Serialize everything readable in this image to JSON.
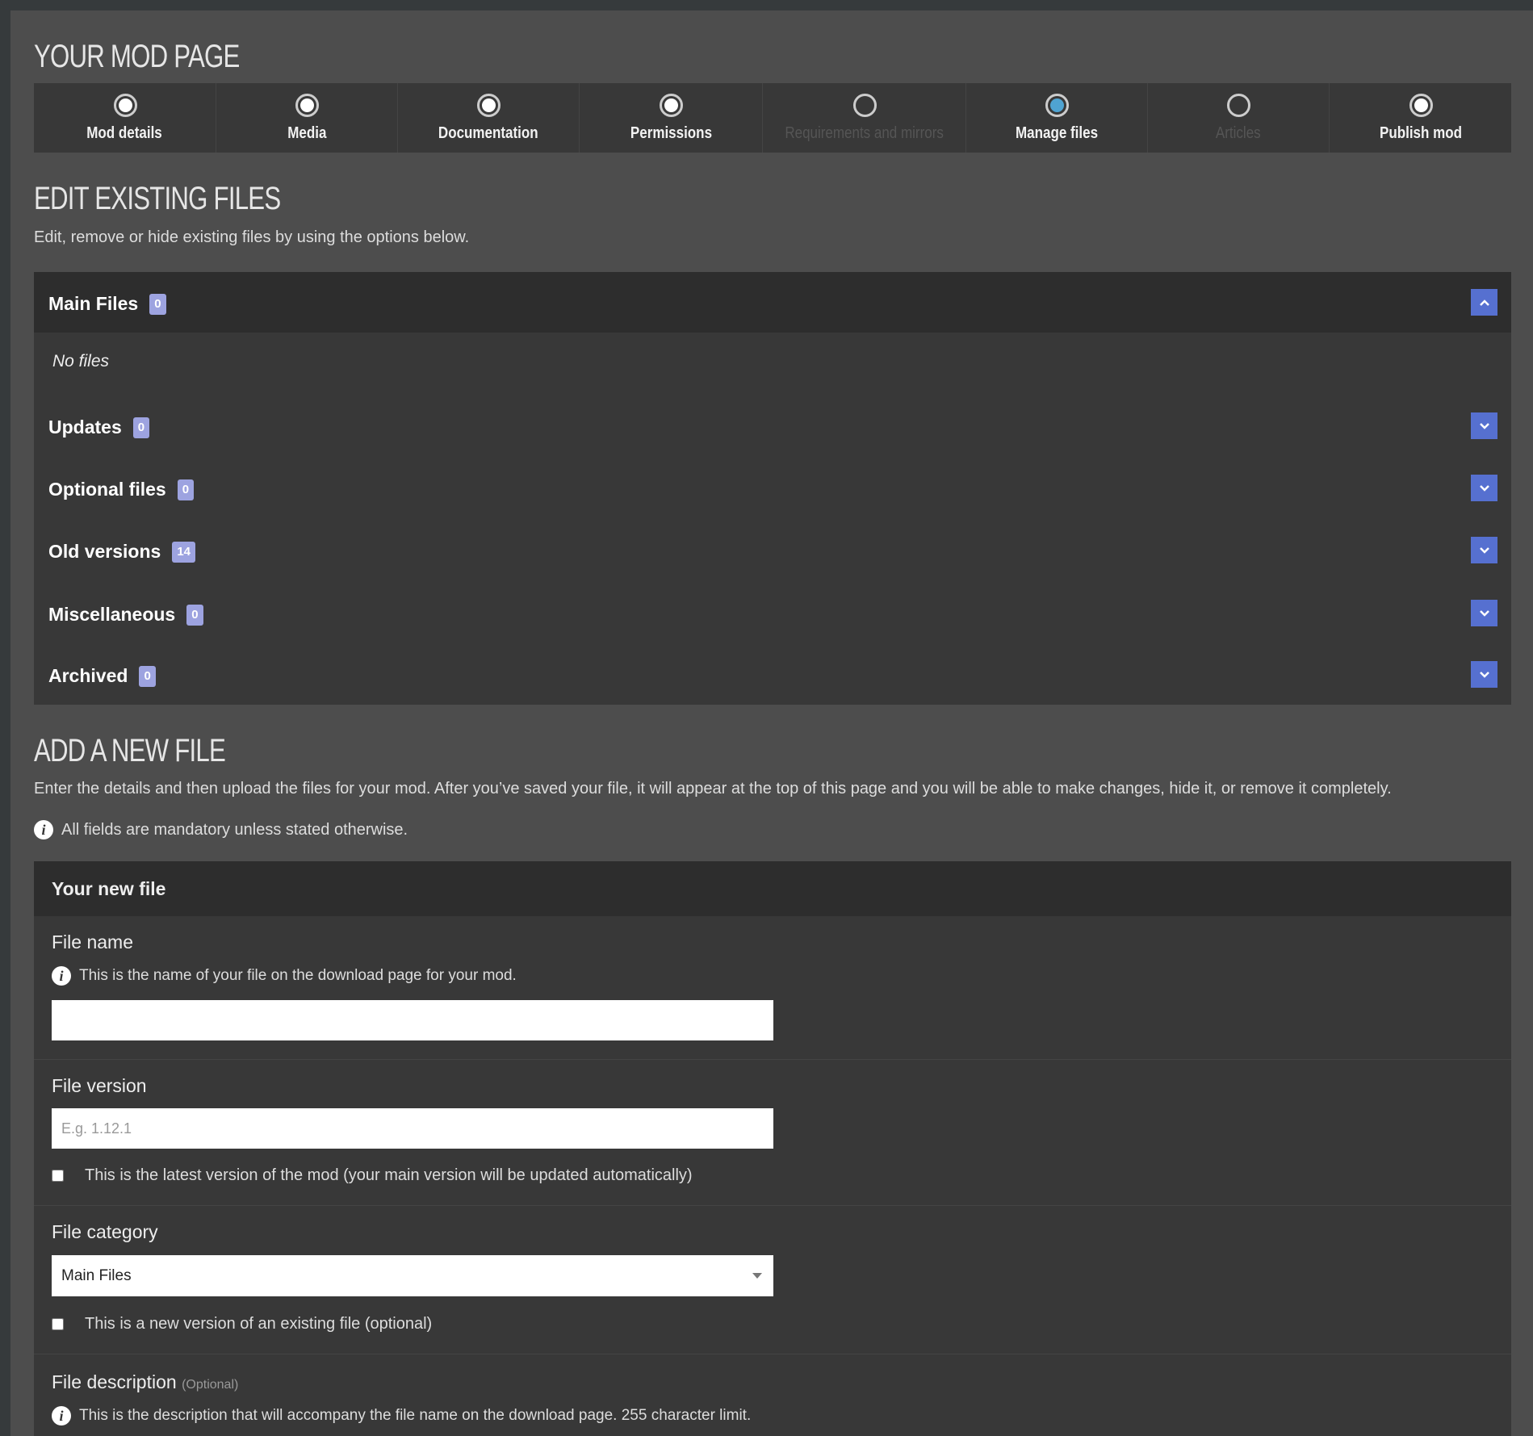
{
  "page_title": "YOUR MOD PAGE",
  "tabs": [
    {
      "label": "Mod details",
      "state": "complete",
      "enabled": true
    },
    {
      "label": "Media",
      "state": "complete",
      "enabled": true
    },
    {
      "label": "Documentation",
      "state": "complete",
      "enabled": true
    },
    {
      "label": "Permissions",
      "state": "complete",
      "enabled": true
    },
    {
      "label": "Requirements and mirrors",
      "state": "empty",
      "enabled": false
    },
    {
      "label": "Manage files",
      "state": "active",
      "enabled": true
    },
    {
      "label": "Articles",
      "state": "empty",
      "enabled": false
    },
    {
      "label": "Publish mod",
      "state": "complete",
      "enabled": true
    }
  ],
  "colors": {
    "accent": "#5670d0",
    "active_tab": "#4fa3d1",
    "badge": "#9da3e0"
  },
  "edit": {
    "title": "EDIT EXISTING FILES",
    "description": "Edit, remove or hide existing files by using the options below.",
    "no_files": "No files",
    "sections": [
      {
        "label": "Main Files",
        "count": "0",
        "expanded": true
      },
      {
        "label": "Updates",
        "count": "0",
        "expanded": false
      },
      {
        "label": "Optional files",
        "count": "0",
        "expanded": false
      },
      {
        "label": "Old versions",
        "count": "14",
        "expanded": false
      },
      {
        "label": "Miscellaneous",
        "count": "0",
        "expanded": false
      },
      {
        "label": "Archived",
        "count": "0",
        "expanded": false
      }
    ]
  },
  "add": {
    "title": "ADD A NEW FILE",
    "description": "Enter the details and then upload the files for your mod. After you’ve saved your file, it will appear at the top of this page and you will be able to make changes, hide it, or remove it completely.",
    "mandatory_note": "All fields are mandatory unless stated otherwise.",
    "form": {
      "header": "Your new file",
      "file_name": {
        "label": "File name",
        "hint": "This is the name of your file on the download page for your mod.",
        "value": ""
      },
      "file_version": {
        "label": "File version",
        "placeholder": "E.g. 1.12.1",
        "value": "",
        "latest_label": "This is the latest version of the mod (your main version will be updated automatically)",
        "latest_checked": false
      },
      "file_category": {
        "label": "File category",
        "selected": "Main Files",
        "new_version_label": "This is a new version of an existing file (optional)",
        "new_version_checked": false
      },
      "file_description": {
        "label": "File description",
        "optional": "(Optional)",
        "hint": "This is the description that will accompany the file name on the download page. 255 character limit."
      }
    }
  }
}
